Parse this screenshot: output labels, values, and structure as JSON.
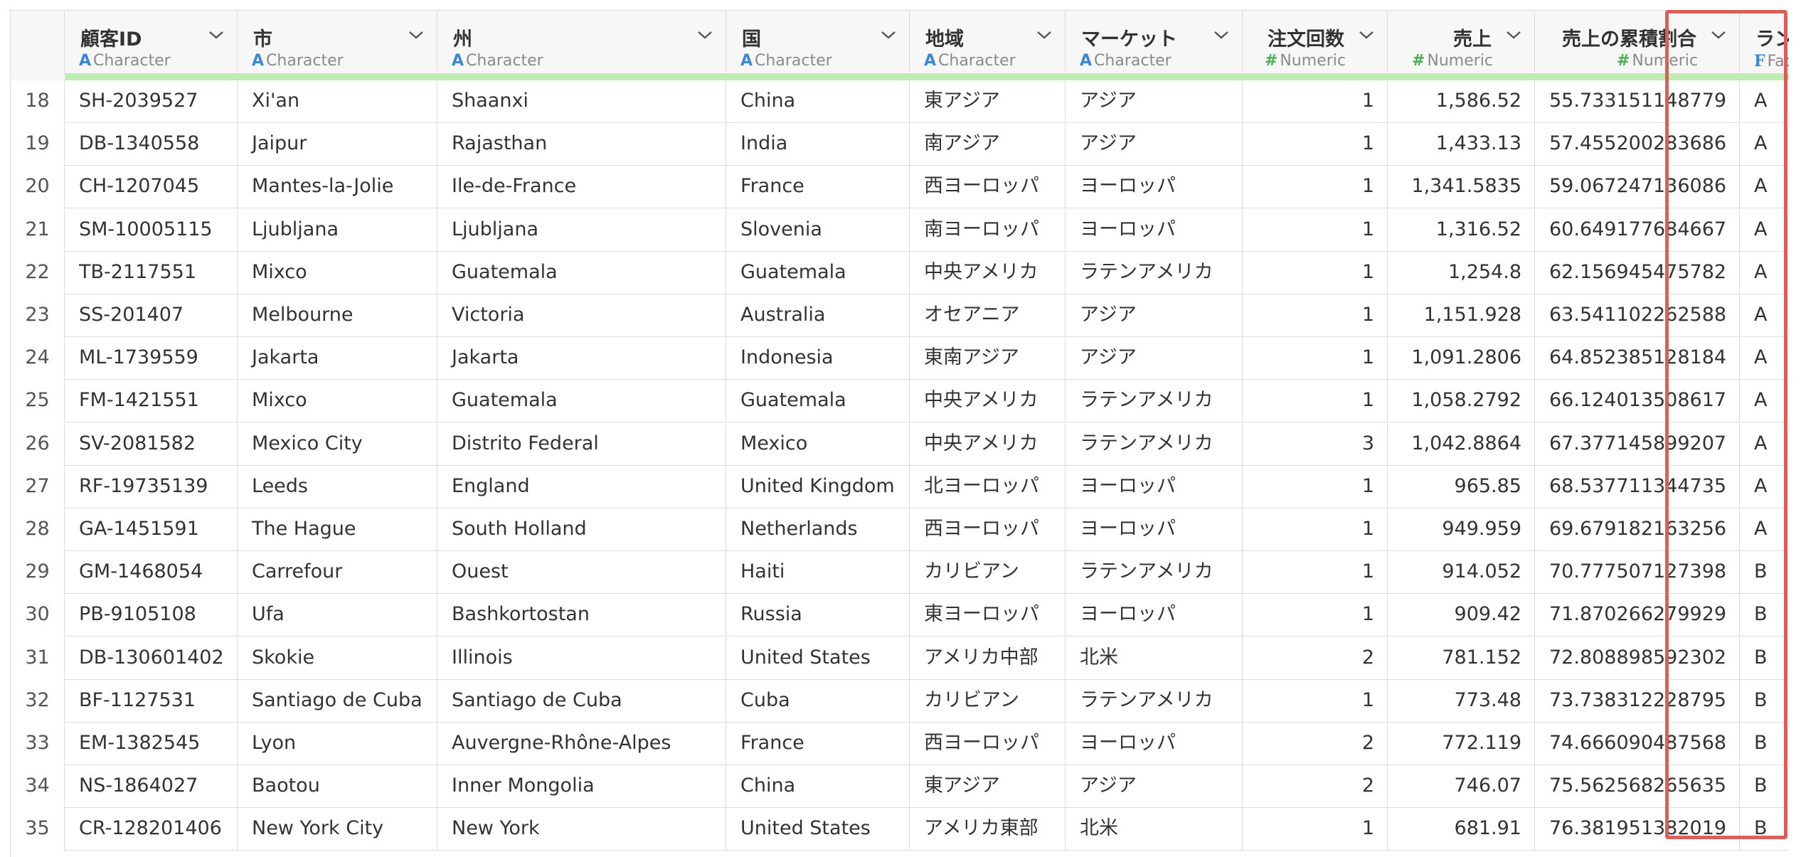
{
  "columns": [
    {
      "key": "id",
      "name": "顧客ID",
      "type": "Character",
      "icon": "character-type-icon",
      "icon_glyph": "A"
    },
    {
      "key": "city",
      "name": "市",
      "type": "Character",
      "icon": "character-type-icon",
      "icon_glyph": "A"
    },
    {
      "key": "state",
      "name": "州",
      "type": "Character",
      "icon": "character-type-icon",
      "icon_glyph": "A"
    },
    {
      "key": "country",
      "name": "国",
      "type": "Character",
      "icon": "character-type-icon",
      "icon_glyph": "A"
    },
    {
      "key": "region",
      "name": "地域",
      "type": "Character",
      "icon": "character-type-icon",
      "icon_glyph": "A"
    },
    {
      "key": "market",
      "name": "マーケット",
      "type": "Character",
      "icon": "character-type-icon",
      "icon_glyph": "A"
    },
    {
      "key": "orders",
      "name": "注文回数",
      "type": "Numeric",
      "icon": "numeric-type-icon",
      "icon_glyph": "#"
    },
    {
      "key": "sales",
      "name": "売上",
      "type": "Numeric",
      "icon": "numeric-type-icon",
      "icon_glyph": "#"
    },
    {
      "key": "cum",
      "name": "売上の累積割合",
      "type": "Numeric",
      "icon": "numeric-type-icon",
      "icon_glyph": "#"
    },
    {
      "key": "rank",
      "name": "ランク",
      "type": "Factor",
      "icon": "factor-type-icon",
      "icon_glyph": "F"
    }
  ],
  "rows": [
    {
      "n": "18",
      "id": "SH-2039527",
      "city": "Xi'an",
      "state": "Shaanxi",
      "country": "China",
      "region": "東アジア",
      "market": "アジア",
      "orders": "1",
      "sales": "1,586.52",
      "cum": "55.733151148779",
      "rank": "A"
    },
    {
      "n": "19",
      "id": "DB-1340558",
      "city": "Jaipur",
      "state": "Rajasthan",
      "country": "India",
      "region": "南アジア",
      "market": "アジア",
      "orders": "1",
      "sales": "1,433.13",
      "cum": "57.455200283686",
      "rank": "A"
    },
    {
      "n": "20",
      "id": "CH-1207045",
      "city": "Mantes-la-Jolie",
      "state": "Ile-de-France",
      "country": "France",
      "region": "西ヨーロッパ",
      "market": "ヨーロッパ",
      "orders": "1",
      "sales": "1,341.5835",
      "cum": "59.067247136086",
      "rank": "A"
    },
    {
      "n": "21",
      "id": "SM-10005115",
      "city": "Ljubljana",
      "state": "Ljubljana",
      "country": "Slovenia",
      "region": "南ヨーロッパ",
      "market": "ヨーロッパ",
      "orders": "1",
      "sales": "1,316.52",
      "cum": "60.649177684667",
      "rank": "A"
    },
    {
      "n": "22",
      "id": "TB-2117551",
      "city": "Mixco",
      "state": "Guatemala",
      "country": "Guatemala",
      "region": "中央アメリカ",
      "market": "ラテンアメリカ",
      "orders": "1",
      "sales": "1,254.8",
      "cum": "62.156945475782",
      "rank": "A"
    },
    {
      "n": "23",
      "id": "SS-201407",
      "city": "Melbourne",
      "state": "Victoria",
      "country": "Australia",
      "region": "オセアニア",
      "market": "アジア",
      "orders": "1",
      "sales": "1,151.928",
      "cum": "63.541102262588",
      "rank": "A"
    },
    {
      "n": "24",
      "id": "ML-1739559",
      "city": "Jakarta",
      "state": "Jakarta",
      "country": "Indonesia",
      "region": "東南アジア",
      "market": "アジア",
      "orders": "1",
      "sales": "1,091.2806",
      "cum": "64.852385128184",
      "rank": "A"
    },
    {
      "n": "25",
      "id": "FM-1421551",
      "city": "Mixco",
      "state": "Guatemala",
      "country": "Guatemala",
      "region": "中央アメリカ",
      "market": "ラテンアメリカ",
      "orders": "1",
      "sales": "1,058.2792",
      "cum": "66.124013508617",
      "rank": "A"
    },
    {
      "n": "26",
      "id": "SV-2081582",
      "city": "Mexico City",
      "state": "Distrito Federal",
      "country": "Mexico",
      "region": "中央アメリカ",
      "market": "ラテンアメリカ",
      "orders": "3",
      "sales": "1,042.8864",
      "cum": "67.377145899207",
      "rank": "A"
    },
    {
      "n": "27",
      "id": "RF-19735139",
      "city": "Leeds",
      "state": "England",
      "country": "United Kingdom",
      "region": "北ヨーロッパ",
      "market": "ヨーロッパ",
      "orders": "1",
      "sales": "965.85",
      "cum": "68.537711344735",
      "rank": "A"
    },
    {
      "n": "28",
      "id": "GA-1451591",
      "city": "The Hague",
      "state": "South Holland",
      "country": "Netherlands",
      "region": "西ヨーロッパ",
      "market": "ヨーロッパ",
      "orders": "1",
      "sales": "949.959",
      "cum": "69.679182163256",
      "rank": "A"
    },
    {
      "n": "29",
      "id": "GM-1468054",
      "city": "Carrefour",
      "state": "Ouest",
      "country": "Haiti",
      "region": "カリビアン",
      "market": "ラテンアメリカ",
      "orders": "1",
      "sales": "914.052",
      "cum": "70.777507127398",
      "rank": "B"
    },
    {
      "n": "30",
      "id": "PB-9105108",
      "city": "Ufa",
      "state": "Bashkortostan",
      "country": "Russia",
      "region": "東ヨーロッパ",
      "market": "ヨーロッパ",
      "orders": "1",
      "sales": "909.42",
      "cum": "71.870266279929",
      "rank": "B"
    },
    {
      "n": "31",
      "id": "DB-130601402",
      "city": "Skokie",
      "state": "Illinois",
      "country": "United States",
      "region": "アメリカ中部",
      "market": "北米",
      "orders": "2",
      "sales": "781.152",
      "cum": "72.808898592302",
      "rank": "B"
    },
    {
      "n": "32",
      "id": "BF-1127531",
      "city": "Santiago de Cuba",
      "state": "Santiago de Cuba",
      "country": "Cuba",
      "region": "カリビアン",
      "market": "ラテンアメリカ",
      "orders": "1",
      "sales": "773.48",
      "cum": "73.738312228795",
      "rank": "B"
    },
    {
      "n": "33",
      "id": "EM-1382545",
      "city": "Lyon",
      "state": "Auvergne-Rhône-Alpes",
      "country": "France",
      "region": "西ヨーロッパ",
      "market": "ヨーロッパ",
      "orders": "2",
      "sales": "772.119",
      "cum": "74.666090487568",
      "rank": "B"
    },
    {
      "n": "34",
      "id": "NS-1864027",
      "city": "Baotou",
      "state": "Inner Mongolia",
      "country": "China",
      "region": "東アジア",
      "market": "アジア",
      "orders": "2",
      "sales": "746.07",
      "cum": "75.562568265635",
      "rank": "B"
    },
    {
      "n": "35",
      "id": "CR-128201406",
      "city": "New York City",
      "state": "New York",
      "country": "United States",
      "region": "アメリカ東部",
      "market": "北米",
      "orders": "1",
      "sales": "681.91",
      "cum": "76.381951382019",
      "rank": "B"
    }
  ],
  "highlight": {
    "column": "rank",
    "color": "#d9605a"
  },
  "colors": {
    "character_icon": "#3a86d8",
    "numeric_icon": "#4cb050",
    "header_bar": "#bdebb1"
  }
}
